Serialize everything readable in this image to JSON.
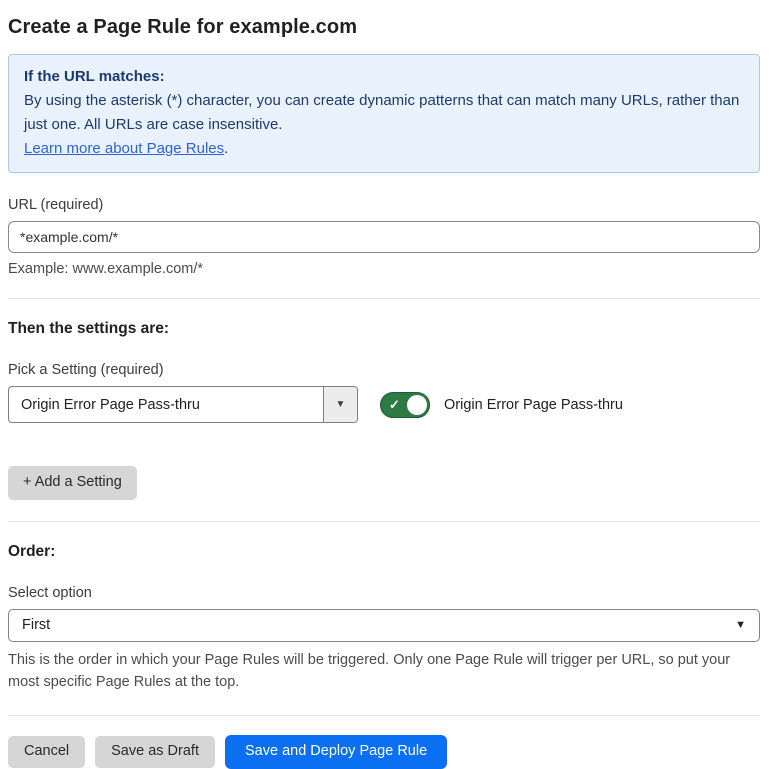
{
  "page": {
    "title": "Create a Page Rule for example.com"
  },
  "info_box": {
    "heading": "If the URL matches:",
    "body": "By using the asterisk (*) character, you can create dynamic patterns that can match many URLs, rather than just one. All URLs are case insensitive.",
    "link_label": "Learn more about Page Rules",
    "link_suffix": "."
  },
  "url_field": {
    "label": "URL (required)",
    "value": "*example.com/*",
    "helper": "Example: www.example.com/*"
  },
  "settings_section": {
    "heading": "Then the settings are:",
    "picker_label": "Pick a Setting (required)",
    "picker_value": "Origin Error Page Pass-thru",
    "toggle_label": "Origin Error Page Pass-thru",
    "toggle_state": "on",
    "add_setting_label": "+ Add a Setting"
  },
  "order_section": {
    "heading": "Order:",
    "select_label": "Select option",
    "select_value": "First",
    "helper": "This is the order in which your Page Rules will be triggered. Only one Page Rule will trigger per URL, so put your most specific Page Rules at the top."
  },
  "footer": {
    "cancel_label": "Cancel",
    "save_draft_label": "Save as Draft",
    "save_deploy_label": "Save and Deploy Page Rule"
  },
  "icons": {
    "check": "✓",
    "caret_down": "▼"
  },
  "colors": {
    "accent_blue": "#0b6ff2",
    "info_bg": "#e9f2fc",
    "info_border": "#abc9ec",
    "info_text": "#1d3a6d",
    "link_blue": "#2f62d9",
    "toggle_green": "#2c7a44"
  }
}
